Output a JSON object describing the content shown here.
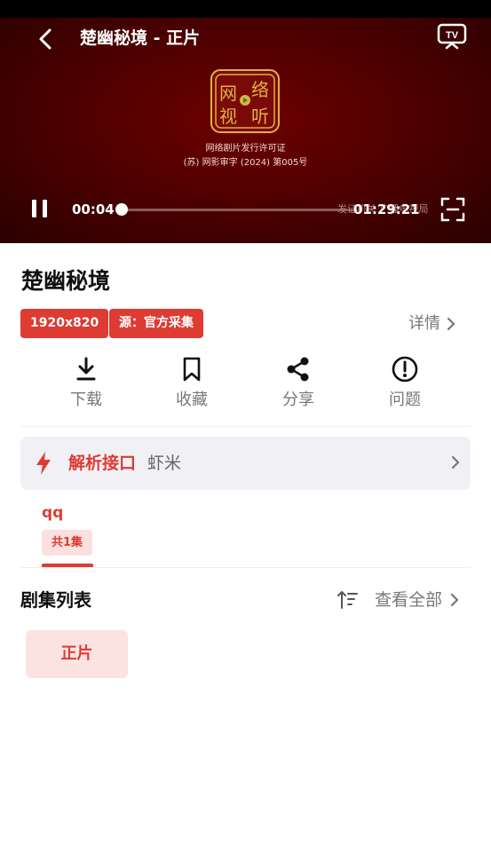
{
  "player": {
    "title": "楚幽秘境 - 正片",
    "license_line1": "网络剧片发行许可证",
    "license_line2": "(苏) 网影审字 (2024) 第005号",
    "current_time": "00:04",
    "duration": "01:29:21",
    "watermark": "发证机关 广播电视局",
    "progress_fraction": 0.002
  },
  "video": {
    "title": "楚幽秘境",
    "tags": [
      "1920x820",
      "源：官方采集"
    ],
    "detail_label": "详情"
  },
  "actions": [
    {
      "label": "下载",
      "icon": "download-icon"
    },
    {
      "label": "收藏",
      "icon": "bookmark-icon"
    },
    {
      "label": "分享",
      "icon": "share-icon"
    },
    {
      "label": "问题",
      "icon": "alert-icon"
    }
  ],
  "parser": {
    "label": "解析接口",
    "value": "虾米"
  },
  "source": {
    "name": "qq",
    "count": "共1集"
  },
  "episodes": {
    "title": "剧集列表",
    "view_all": "查看全部",
    "items": [
      "正片"
    ]
  },
  "colors": {
    "accent": "#de3b33",
    "player_bg": "#4a0000"
  }
}
